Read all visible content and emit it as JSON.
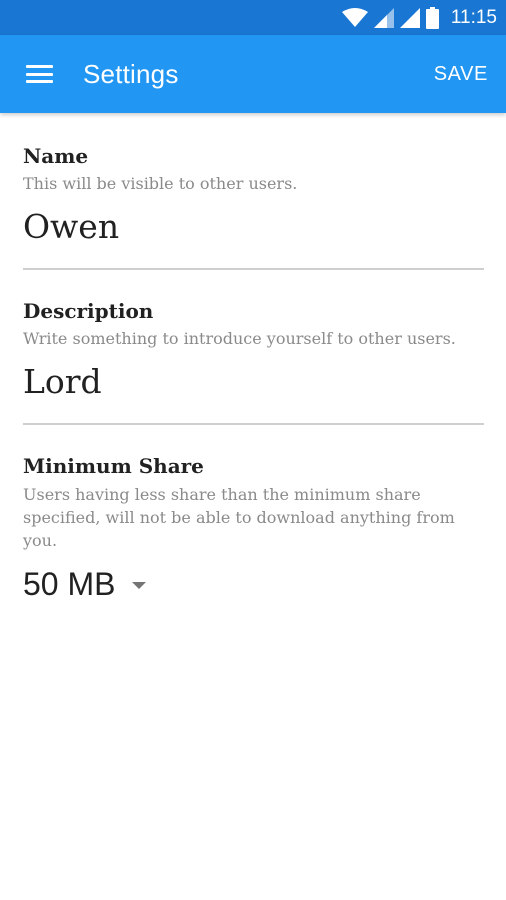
{
  "status_bar": {
    "time": "11:15",
    "icons": [
      "wifi-icon",
      "signal-icon",
      "signal-icon",
      "battery-icon"
    ]
  },
  "app_bar": {
    "title": "Settings",
    "menu_icon": "menu-icon",
    "save_label": "SAVE",
    "color": "#2196F3",
    "status_color": "#1976D2"
  },
  "name_section": {
    "title": "Name",
    "hint": "This will be visible to other users.",
    "value": "Owen"
  },
  "description_section": {
    "title": "Description",
    "hint": "Write something to introduce yourself to other users.",
    "value": "Lord"
  },
  "minimum_share_section": {
    "title": "Minimum Share",
    "hint": "Users having less share than the minimum share specified, will not be able to download anything from you.",
    "selected_value": "50 MB",
    "dropdown_icon": "dropdown-arrow-icon"
  }
}
